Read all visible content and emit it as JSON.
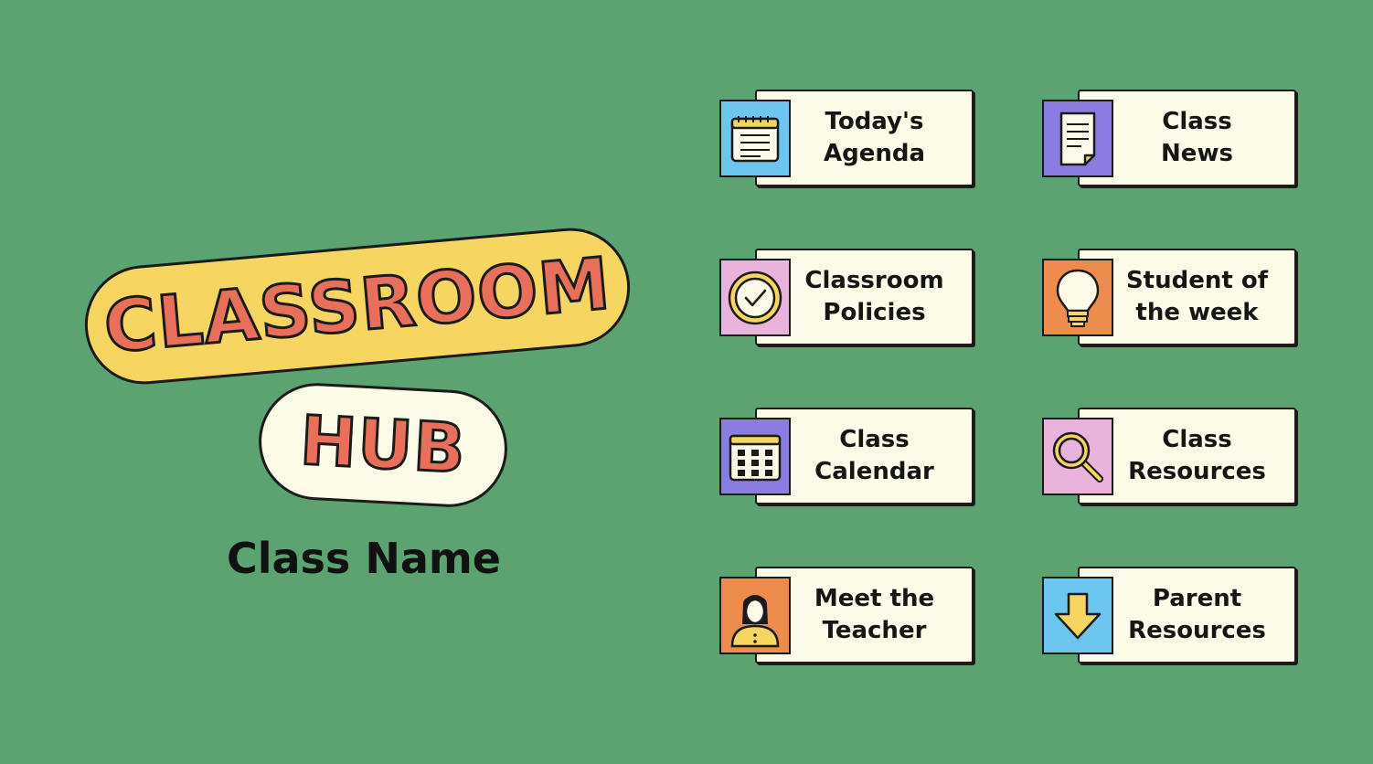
{
  "hub": {
    "title_word1": "CLASSROOM",
    "title_word2": "HUB",
    "class_name": "Class Name"
  },
  "cards": [
    {
      "label": "Today's\nAgenda",
      "icon": "notepad-icon",
      "color": "#6cc6ef"
    },
    {
      "label": "Class\nNews",
      "icon": "document-icon",
      "color": "#8a7ce0"
    },
    {
      "label": "Classroom\nPolicies",
      "icon": "checkmark-circle-icon",
      "color": "#e9b3dc"
    },
    {
      "label": "Student of\nthe week",
      "icon": "lightbulb-icon",
      "color": "#ee8c4d"
    },
    {
      "label": "Class\nCalendar",
      "icon": "calendar-icon",
      "color": "#8a7ce0"
    },
    {
      "label": "Class\nResources",
      "icon": "magnifier-icon",
      "color": "#e9b3dc"
    },
    {
      "label": "Meet the\nTeacher",
      "icon": "teacher-icon",
      "color": "#ee8c4d"
    },
    {
      "label": "Parent\nResources",
      "icon": "down-arrow-icon",
      "color": "#6cc6ef"
    }
  ]
}
